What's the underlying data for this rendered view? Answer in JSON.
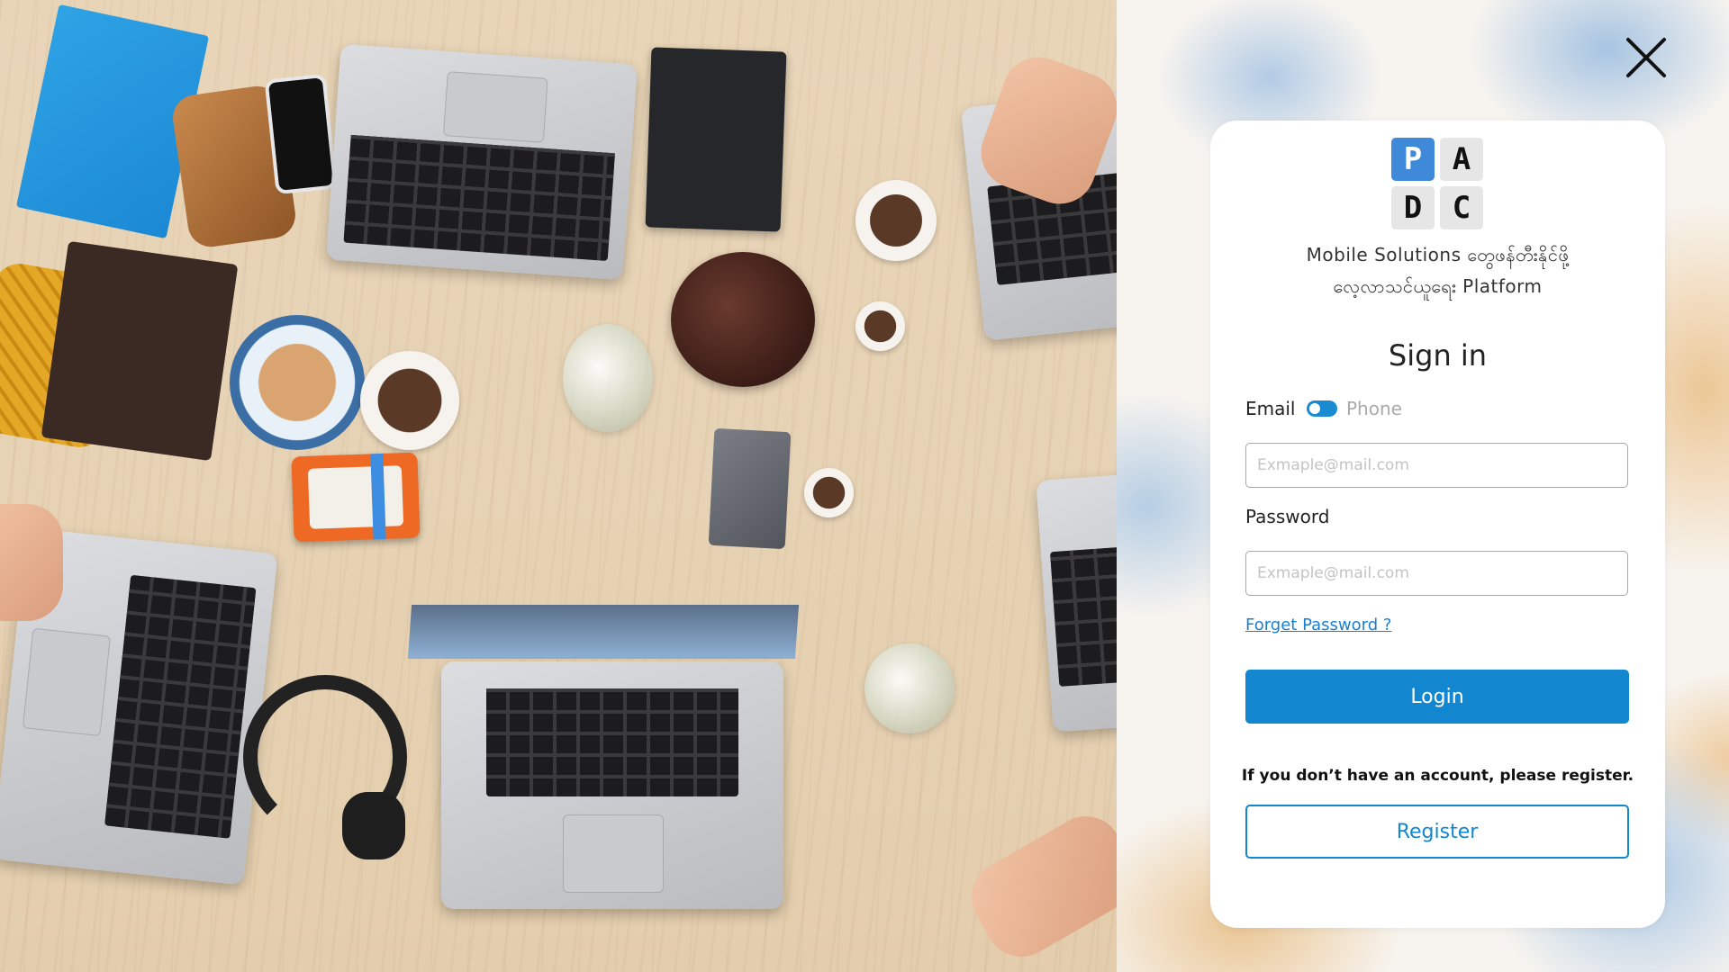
{
  "modal": {
    "close_icon": "close-icon"
  },
  "logo": {
    "letters": [
      "P",
      "A",
      "D",
      "C"
    ],
    "highlight_color": "#3f8ad8"
  },
  "tagline": {
    "line1": "Mobile  Solutions  တွေဖန်တီးနိုင်ဖို့",
    "line2": "လေ့လာသင်ယူရေး  Platform"
  },
  "form": {
    "title": "Sign in",
    "email_label": "Email",
    "phone_label": "Phone",
    "toggle_state": "email",
    "email_placeholder": "Exmaple@mail.com",
    "email_value": "",
    "password_label": "Password",
    "password_placeholder": "Exmaple@mail.com",
    "password_value": "",
    "forgot_password": "Forget Password ?",
    "login_button": "Login",
    "register_note": "If you don’t have an account, please register.",
    "register_button": "Register"
  },
  "colors": {
    "primary": "#1286cf",
    "link": "#1a7fd1"
  }
}
